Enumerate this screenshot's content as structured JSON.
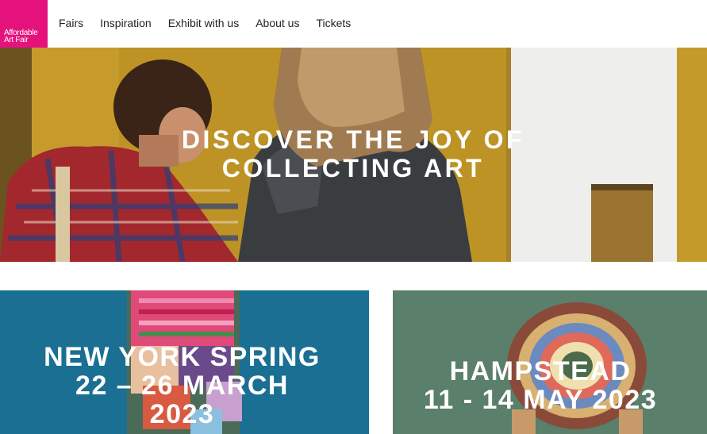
{
  "logo": {
    "line1": "Affordable",
    "line2": "Art Fair"
  },
  "nav": {
    "items": [
      {
        "label": "Fairs"
      },
      {
        "label": "Inspiration"
      },
      {
        "label": "Exhibit with us"
      },
      {
        "label": "About us"
      },
      {
        "label": "Tickets"
      }
    ]
  },
  "hero": {
    "title_line1": "DISCOVER THE JOY OF",
    "title_line2": "COLLECTING ART"
  },
  "cards": [
    {
      "line1": "NEW YORK SPRING",
      "line2": "22 – 26 MARCH",
      "line3": "2023"
    },
    {
      "line1": "HAMPSTEAD",
      "line2": "11 - 14 MAY 2023"
    }
  ],
  "colors": {
    "brand": "#e5127d",
    "ny_card": "#1a6f93",
    "hampstead_card": "#5a7f6a",
    "hero_gold": "#c9a02a"
  }
}
